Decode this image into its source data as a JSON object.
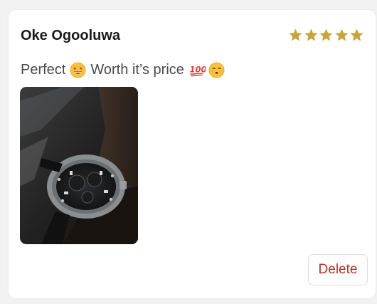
{
  "review": {
    "reviewer_name": "Oke Ogooluwa",
    "rating": 5,
    "rating_max": 5,
    "text_part_1": "Perfect",
    "text_part_2": "Worth it’s price",
    "emojis": [
      "star-struck-emoji",
      "hundred-points-emoji",
      "kissing-smiling-eyes-emoji"
    ],
    "photo_icon": "wristwatch-photo",
    "delete_label": "Delete"
  },
  "colors": {
    "star": "#c9a43a",
    "delete_text": "#b0352b",
    "name_text": "#1b1b1b",
    "body_text": "#4b4b4b"
  }
}
